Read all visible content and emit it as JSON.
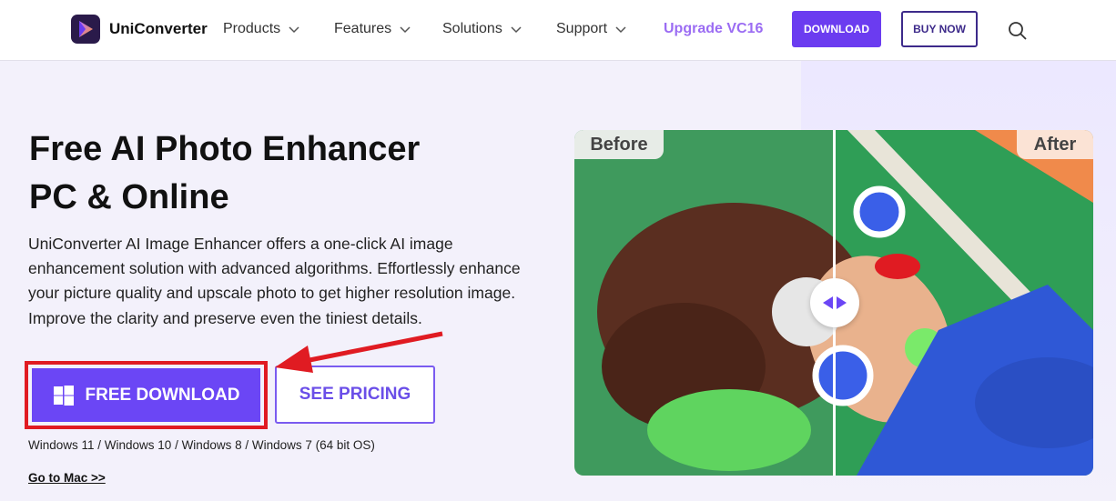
{
  "nav": {
    "brand": "UniConverter",
    "items": [
      {
        "label": "Products"
      },
      {
        "label": "Features"
      },
      {
        "label": "Solutions"
      },
      {
        "label": "Support"
      }
    ],
    "upgrade": "Upgrade VC16",
    "download": "DOWNLOAD",
    "buy_now": "BUY NOW"
  },
  "hero": {
    "title_line1": "Free AI Photo Enhancer",
    "title_line2": "PC & Online",
    "description": "UniConverter AI Image Enhancer offers a one-click AI image enhancement solution with advanced algorithms. Effortlessly enhance your picture quality and upscale photo to get higher resolution image. Improve the clarity and preserve even the tiniest details.",
    "free_download": "FREE DOWNLOAD",
    "see_pricing": "SEE PRICING",
    "os_note": "Windows 11 / Windows 10 / Windows 8 / Windows 7 (64 bit OS)",
    "mac_link": "Go to Mac >>"
  },
  "compare": {
    "before": "Before",
    "after": "After"
  },
  "colors": {
    "accent": "#6b46f5",
    "upgrade": "#9b6cf3",
    "highlight": "#e01b22"
  }
}
